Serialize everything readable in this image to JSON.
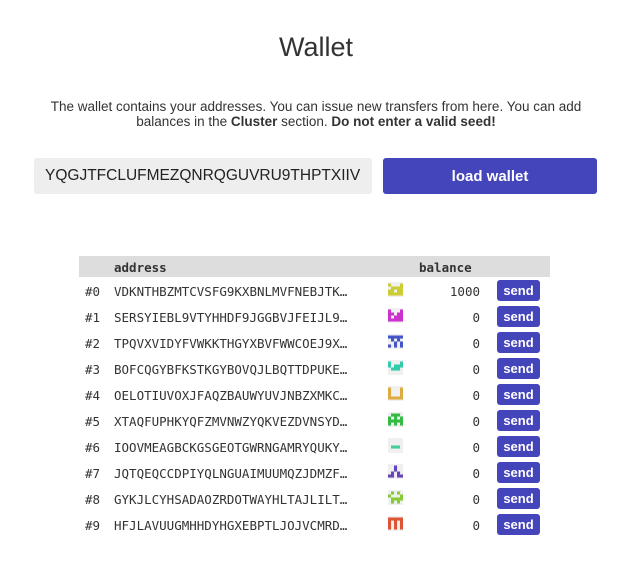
{
  "page": {
    "title": "Wallet",
    "description_1": "The wallet contains your addresses. You can issue new transfers from here. You can add balances in the ",
    "description_cluster": "Cluster",
    "description_2": " section. ",
    "description_warning": "Do not enter a valid seed!"
  },
  "seed_input": {
    "value": "YQGJTFCLUFMEZQNRQGUVRU9THPTXIIV",
    "placeholder": ""
  },
  "load_button": {
    "label": "load wallet"
  },
  "table": {
    "headers": {
      "index": "",
      "address": "address",
      "balance": "balance"
    },
    "send_label": "send",
    "rows": [
      {
        "index": "#0",
        "address": "VDKNTHBZMTCVSFG9KXBNLMVFNEBJTK…",
        "balance": "1000",
        "identicon_color": "#cccc33",
        "identicon_pattern": "10001011111101111111"
      },
      {
        "index": "#1",
        "address": "SERSYIEBL9VTYHHDF9JGGBVJFEIJL9…",
        "balance": "0",
        "identicon_color": "#cc33cc",
        "identicon_pattern": "10001110111011111111"
      },
      {
        "index": "#2",
        "address": "TPQVXVIDYFVWKKTHGYXBVFWWCOEJ9X…",
        "balance": "0",
        "identicon_color": "#4455cc",
        "identicon_pattern": "11111010100010110101"
      },
      {
        "index": "#3",
        "address": "BOFCQGYBFKSTKGYBOVQJLBQTTDPUKE…",
        "balance": "0",
        "identicon_color": "#33ccaa",
        "identicon_pattern": "10001101110111000000"
      },
      {
        "index": "#4",
        "address": "OELOTIUVOXJFAQZBAUWYUVJNBZXMKC…",
        "balance": "0",
        "identicon_color": "#ddaa44",
        "identicon_pattern": "10001100011000111111"
      },
      {
        "index": "#5",
        "address": "XTAQFUPHKYQFZMVNWZYQKVEZDVNSYD…",
        "balance": "0",
        "identicon_color": "#33bb44",
        "identicon_pattern": "01110101011111110101"
      },
      {
        "index": "#6",
        "address": "IOOVMEAGBCKGSGEOTGWRNGAMRYQUKY…",
        "balance": "0",
        "identicon_color": "#44cc99",
        "identicon_pattern": "00000000000111000000"
      },
      {
        "index": "#7",
        "address": "JQTQEQCCDPIYQLNGUAIMUUMQZJDMZF…",
        "balance": "0",
        "identicon_color": "#6644bb",
        "identicon_pattern": "00100001000101011011"
      },
      {
        "index": "#8",
        "address": "GYKJLCYHSADAOZRDOTWAYHLTAJLILT…",
        "balance": "0",
        "identicon_color": "#88cc33",
        "identicon_pattern": "01010100010111101010"
      },
      {
        "index": "#9",
        "address": "HFJLAVUUGMHHDYHGXEBPTLJOJVCMRD…",
        "balance": "0",
        "identicon_color": "#dd5533",
        "identicon_pattern": "11111101011010110101"
      }
    ]
  }
}
